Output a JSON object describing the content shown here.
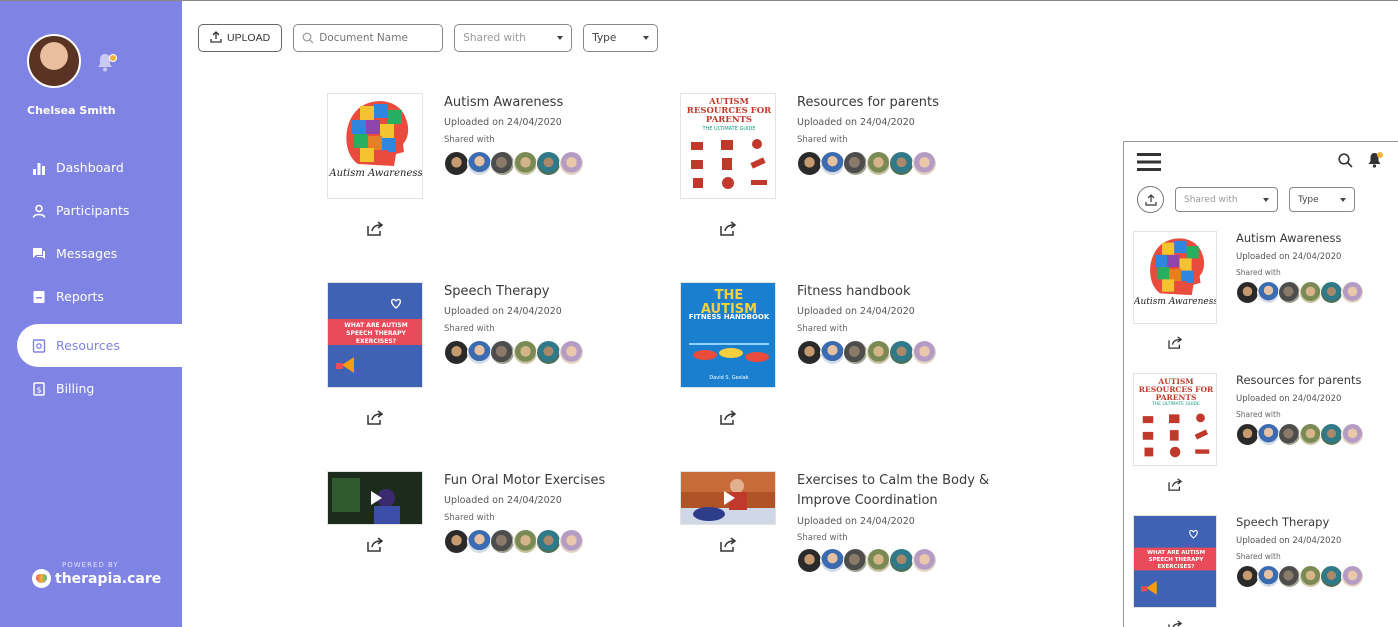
{
  "user": {
    "name": "Chelsea Smith"
  },
  "nav": [
    {
      "label": "Dashboard",
      "icon": "bar-chart-icon"
    },
    {
      "label": "Participants",
      "icon": "person-icon"
    },
    {
      "label": "Messages",
      "icon": "chat-icon"
    },
    {
      "label": "Reports",
      "icon": "report-icon"
    },
    {
      "label": "Resources",
      "icon": "resources-icon",
      "active": true
    },
    {
      "label": "Billing",
      "icon": "billing-icon"
    }
  ],
  "brand": {
    "powered_by": "POWERED BY",
    "name": "therapia.care"
  },
  "toolbar": {
    "upload_label": "UPLOAD",
    "search_placeholder": "Document Name",
    "shared_with": "Shared with",
    "type": "Type"
  },
  "resources": [
    {
      "title": "Autism Awareness",
      "uploaded": "Uploaded on 24/04/2020",
      "shared_label": "Shared with",
      "thumb_caption": "Autism Awareness"
    },
    {
      "title": "Resources for parents",
      "uploaded": "Uploaded on 24/04/2020",
      "shared_label": "Shared with",
      "thumb_title": "AUTISM RESOURCES FOR PARENTS",
      "thumb_sub": "THE ULTIMATE GUIDE"
    },
    {
      "title": "Speech Therapy",
      "uploaded": "Uploaded on 24/04/2020",
      "shared_label": "Shared with",
      "thumb_text": "WHAT ARE AUTISM SPEECH THERAPY EXERCISES?"
    },
    {
      "title": "Fitness handbook",
      "uploaded": "Uploaded on 24/04/2020",
      "shared_label": "Shared with",
      "thumb_title": "THE AUTISM",
      "thumb_sub": "FITNESS HANDBOOK",
      "thumb_author": "David S. Geslak"
    },
    {
      "title": "Fun Oral Motor Exercises",
      "uploaded": "Uploaded on 24/04/2020",
      "shared_label": "Shared with"
    },
    {
      "title": "Exercises to Calm the Body & Improve Coordination",
      "uploaded": "Uploaded on 24/04/2020",
      "shared_label": "Shared with"
    }
  ],
  "mobile": {
    "shared_with": "Shared with",
    "type": "Type",
    "resources": [
      {
        "title": "Autism Awareness",
        "uploaded": "Uploaded on 24/04/2020",
        "shared_label": "Shared with",
        "thumb_caption": "Autism Awareness"
      },
      {
        "title": "Resources for parents",
        "uploaded": "Uploaded on 24/04/2020",
        "shared_label": "Shared with",
        "thumb_title": "AUTISM RESOURCES FOR PARENTS",
        "thumb_sub": "THE ULTIMATE GUIDE"
      },
      {
        "title": "Speech Therapy",
        "uploaded": "Uploaded on 24/04/2020",
        "shared_label": "Shared with",
        "thumb_text": "WHAT ARE AUTISM SPEECH THERAPY EXERCISES?"
      }
    ]
  },
  "colors": {
    "sidebar": "#7f83e3",
    "accent_dot": "#f3b03a"
  }
}
